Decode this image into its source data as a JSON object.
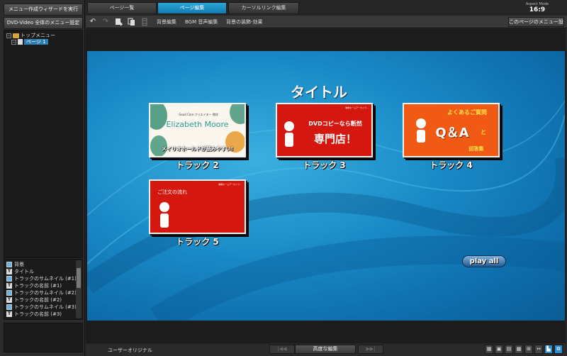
{
  "left_panel": {
    "wizard_button": "メニュー作成ウィザードを実行",
    "dvd_settings_button": "DVD-Video 全体のメニュー設定",
    "tree": {
      "expander_top": "−",
      "expander_child": "−",
      "root": "トップメニュー",
      "child": "ページ 1"
    },
    "layers": [
      {
        "icon": "image-icon",
        "label": "背景"
      },
      {
        "icon": "text-icon",
        "glyph": "T",
        "label": "タイトル"
      },
      {
        "icon": "image-icon",
        "label": "トラックのサムネイル (#1)"
      },
      {
        "icon": "text-icon",
        "glyph": "T",
        "label": "トラックの名前 (#1)"
      },
      {
        "icon": "image-icon",
        "label": "トラックのサムネイル (#2)"
      },
      {
        "icon": "text-icon",
        "glyph": "T",
        "label": "トラックの名前 (#2)"
      },
      {
        "icon": "image-icon",
        "label": "トラックのサムネイル (#3)"
      },
      {
        "icon": "text-icon",
        "glyph": "T",
        "label": "トラックの名前 (#3)"
      }
    ]
  },
  "tabs": [
    {
      "label": "ページ一覧",
      "active": false
    },
    {
      "label": "ページ編集",
      "active": true
    },
    {
      "label": "カーソルリンク編集",
      "active": false
    }
  ],
  "aspect": {
    "label": "Aspect Mode",
    "value": "16:9"
  },
  "toolbar": {
    "undo_icon": "↶",
    "redo_icon": "↷",
    "menu_background": "背景編集",
    "menu_bgm": "BGM 音声編集",
    "menu_effects": "背景の装飾-効果",
    "page_settings_button": "このページのメニュー設定"
  },
  "canvas": {
    "title": "タイトル",
    "tracks": [
      {
        "label": "トラック 2",
        "thumb_name": "Elizabeth Moore",
        "thumb_caption": "メイリオホールドが読みやすい!",
        "thumb_small": "Good Care クリエイター 賞状"
      },
      {
        "label": "トラック 3",
        "thumb_line1": "DVDコピーなら断然",
        "thumb_line2": "専門店！",
        "thumb_header": "映像ホームアーカイブ…"
      },
      {
        "label": "トラック 4",
        "thumb_line1": "よくあるご質問",
        "thumb_qa": "Q＆A",
        "thumb_to": "と",
        "thumb_line3": "回答集"
      },
      {
        "label": "トラック 5",
        "thumb_line1": "ご注文の流れ",
        "thumb_header": "映像ホームアーカイブ…"
      }
    ],
    "play_all": "play all"
  },
  "bottom": {
    "status_label": "ユーザーオリジナル",
    "prev_icon": "|◀◀",
    "next_icon": "▶▶|",
    "advanced_edit": "高度な編集"
  },
  "colors": {
    "accent": "#1a8fcf",
    "thumb_red": "#d4170f",
    "thumb_orange": "#f05a14"
  }
}
